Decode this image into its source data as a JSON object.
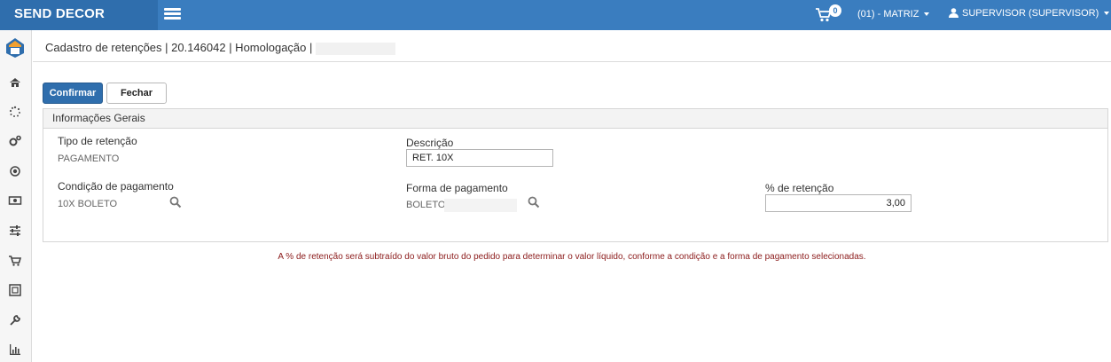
{
  "header": {
    "brand": "SEND DECOR",
    "cart_count": "0",
    "company": "(01) - MATRIZ",
    "user": "SUPERVISOR (SUPERVISOR)"
  },
  "sidebar": {
    "items": [
      "home-icon",
      "spinner-icon",
      "cogs-icon",
      "target-icon",
      "money-icon",
      "sliders-icon",
      "cart-icon",
      "building-icon",
      "wrench-icon",
      "bar-chart-icon"
    ]
  },
  "page": {
    "breadcrumb": "Cadastro de retenções | 20.146042 | Homologação |"
  },
  "toolbar": {
    "confirm_label": "Confirmar",
    "close_label": "Fechar"
  },
  "form": {
    "section_title": "Informações Gerais",
    "tipo_label": "Tipo de retenção",
    "tipo_value": "PAGAMENTO",
    "descricao_label": "Descrição",
    "descricao_value": "RET. 10X",
    "condicao_label": "Condição de pagamento",
    "condicao_value": "10X BOLETO",
    "forma_label": "Forma de pagamento",
    "forma_value": "BOLETO",
    "retencao_label": "% de retenção",
    "retencao_value": "3,00"
  },
  "note": "A % de retenção será subtraído do valor bruto do pedido para determinar o valor líquido, conforme a condição e a forma de pagamento selecionadas.",
  "colors": {
    "primary": "#3a7dbf",
    "brand_bg": "#2f6ead",
    "note": "#8b1a1a"
  }
}
